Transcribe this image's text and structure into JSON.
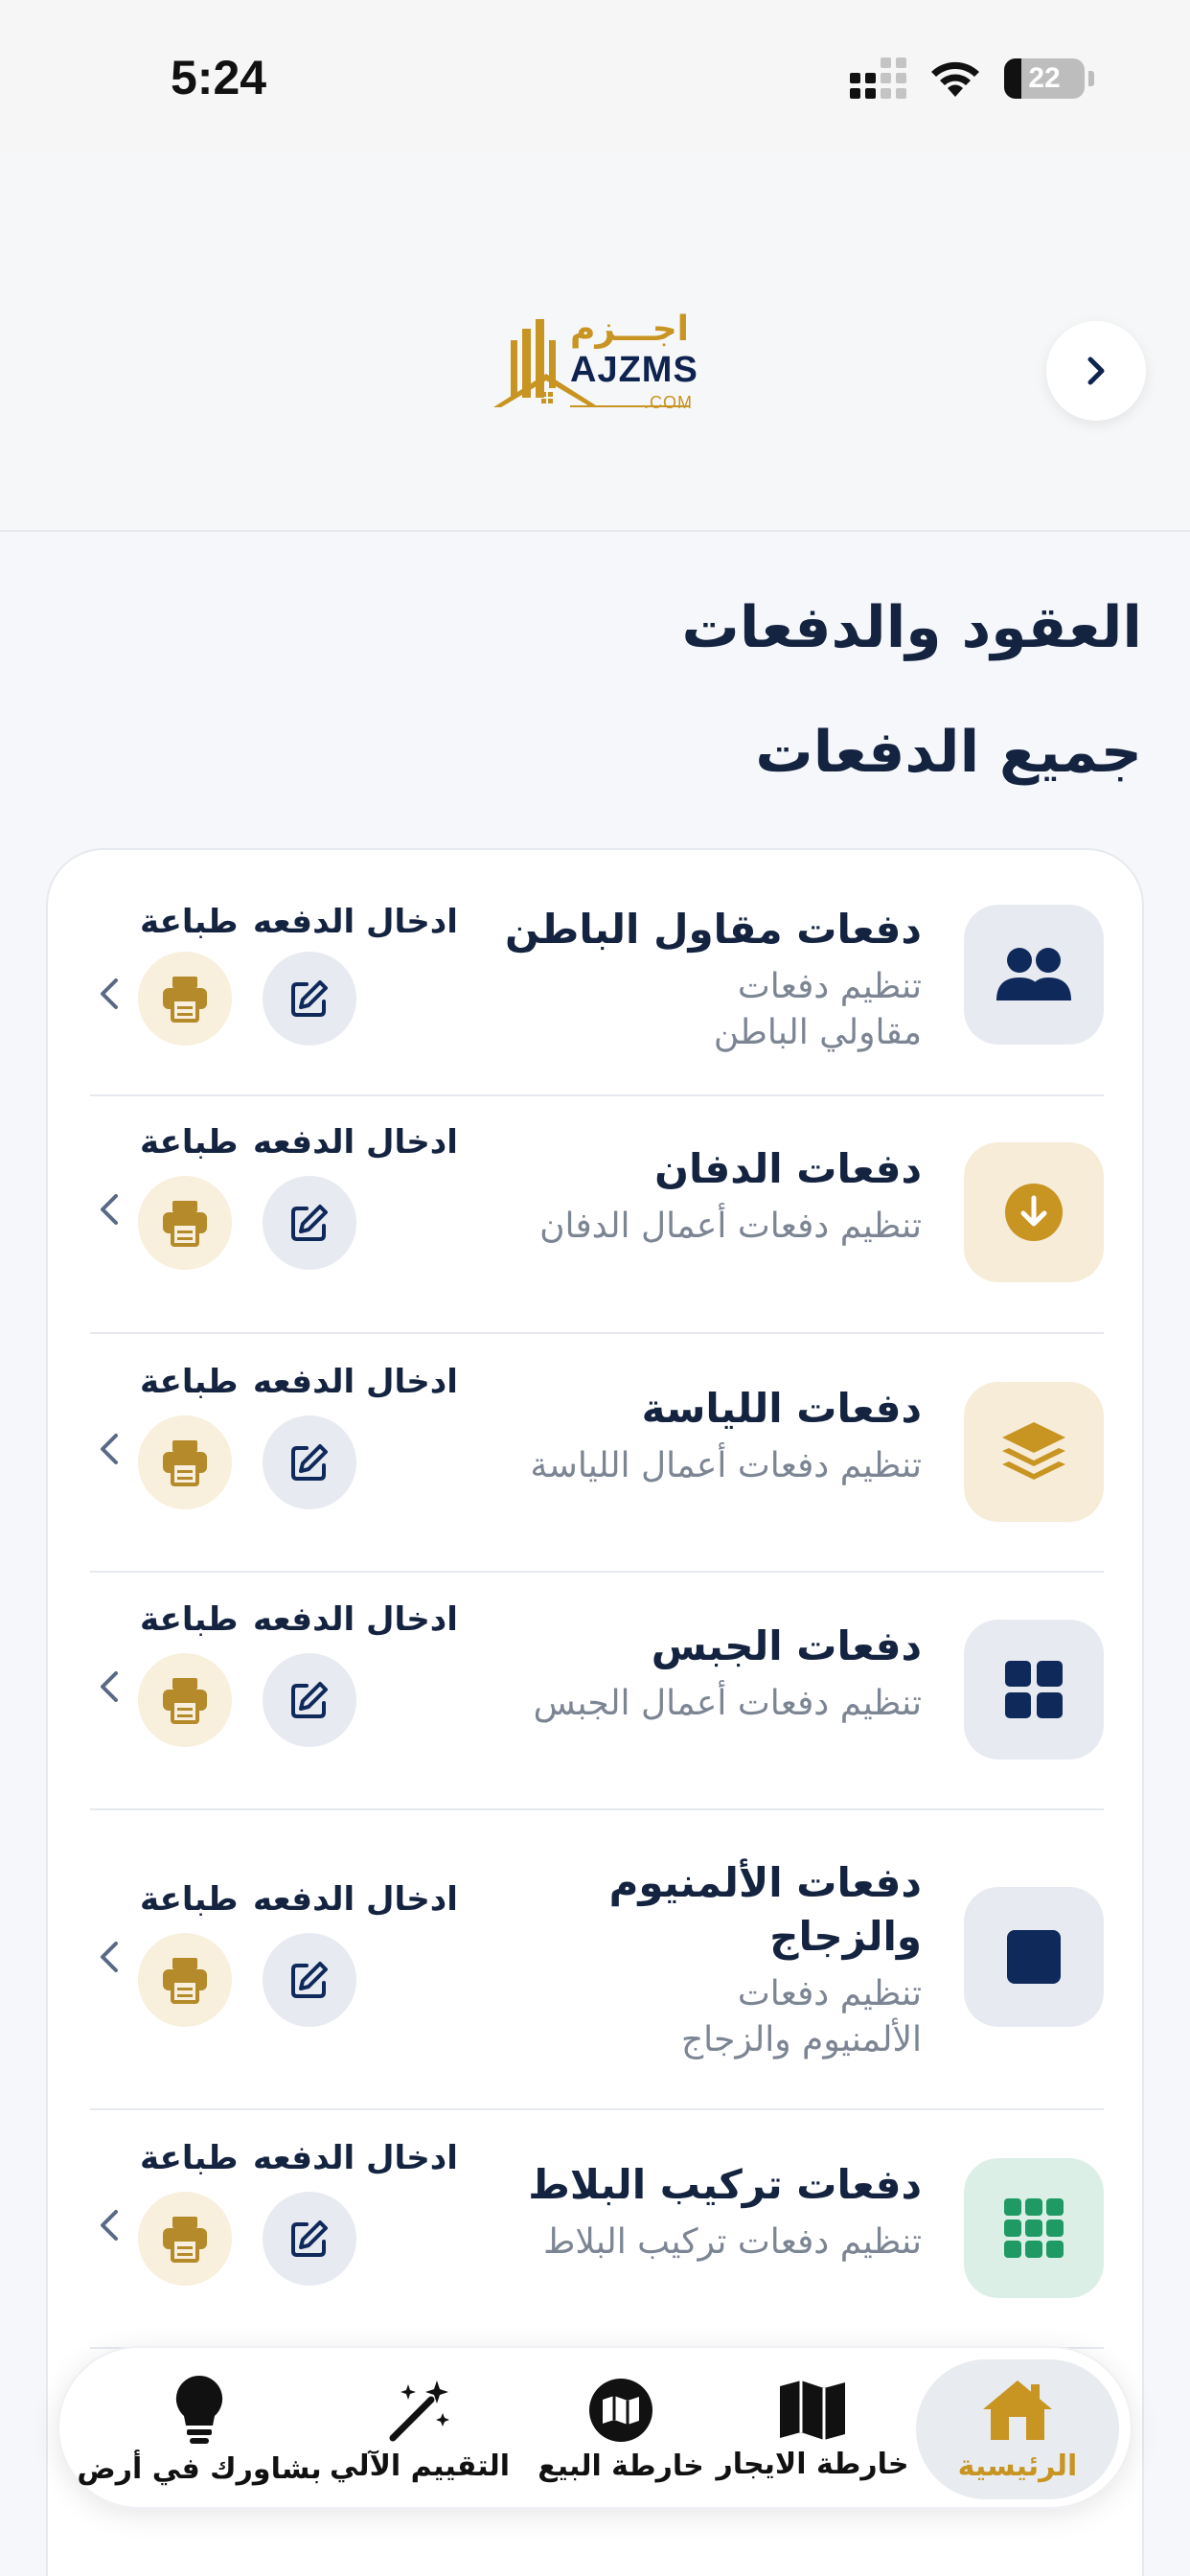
{
  "status_bar": {
    "time": "5:24",
    "battery": "22",
    "battery_level_percent": 22
  },
  "header": {
    "logo_ar": "اجـــزم",
    "logo_en": "AJZMS",
    "logo_com": ".COM",
    "back_icon": "chevron-right-icon"
  },
  "page": {
    "title": "العقود والدفعات",
    "section_title": "جميع الدفعات"
  },
  "actions": {
    "enter_label": "ادخال الدفعه",
    "print_label": "طباعة"
  },
  "rows": [
    {
      "title": "دفعات مقاول الباطن",
      "subtitle": "تنظيم دفعات مقاولي الباطن",
      "icon": "users-icon",
      "bg": "gray",
      "color": "#0f2a5a"
    },
    {
      "title": "دفعات الدفان",
      "subtitle": "تنظيم دفعات أعمال الدفان",
      "icon": "download-circle-icon",
      "bg": "gold",
      "color": "#c89422"
    },
    {
      "title": "دفعات اللياسة",
      "subtitle": "تنظيم دفعات أعمال اللياسة",
      "icon": "layers-icon",
      "bg": "gold",
      "color": "#c89422"
    },
    {
      "title": "دفعات الجبس",
      "subtitle": "تنظيم دفعات أعمال الجبس",
      "icon": "grid-2x2-icon",
      "bg": "gray",
      "color": "#0f2a5a"
    },
    {
      "title": "دفعات الألمنيوم والزجاج",
      "subtitle": "تنظيم دفعات الألمنيوم والزجاج",
      "icon": "square-icon",
      "bg": "gray",
      "color": "#0f2a5a"
    },
    {
      "title": "دفعات تركيب البلاط",
      "subtitle": "تنظيم دفعات تركيب البلاط",
      "icon": "grid-3x3-icon",
      "bg": "green",
      "color": "#1f9a64"
    }
  ],
  "bottom_nav": [
    {
      "label": "الرئيسية",
      "icon": "home-icon",
      "active": true
    },
    {
      "label": "خارطة الايجار",
      "icon": "map-icon",
      "active": false
    },
    {
      "label": "خارطة البيع",
      "icon": "map-circle-icon",
      "active": false
    },
    {
      "label": "التقييم الآلي",
      "icon": "magic-wand-icon",
      "active": false
    },
    {
      "label": "بشاورك في أرض",
      "icon": "lightbulb-icon",
      "active": false
    }
  ]
}
